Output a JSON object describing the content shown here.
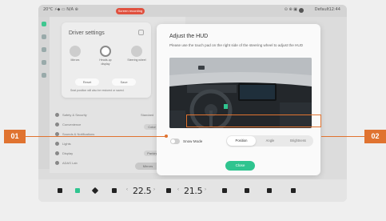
{
  "status": {
    "left": "20°C  ⚡◆  ▭ N/A  ⊕",
    "recording": "Screen recording",
    "right": "⊙   ⊕   ▣",
    "user": "Default",
    "time": "12:44"
  },
  "driver_settings": {
    "title": "Driver settings",
    "modes": [
      "Mirrors",
      "Heads-up display",
      "Steering wheel"
    ],
    "reset_label": "Reset",
    "save_label": "Save",
    "note": "Seat position will also be restored or saved."
  },
  "background_rows": [
    "Safety & Security",
    "Convenience",
    "Sounds & Notifications",
    "Lights",
    "Display",
    "ADAS Lab"
  ],
  "background_labels": {
    "standard": "Standard",
    "color": "Color",
    "parking": "Parking",
    "mirrors": "Mirrors"
  },
  "hud_dialog": {
    "title": "Adjust the HUD",
    "description": "Please use the touch pad on the right side of the steering wheel to adjust the HUD",
    "snow_mode_label": "Snow Mode",
    "snow_mode_on": false,
    "tabs": [
      "Position",
      "Angle",
      "Brightness"
    ],
    "active_tab": "Position",
    "close_label": "Close"
  },
  "dock": {
    "left_temp": "22.5",
    "right_temp": "21.5"
  },
  "callouts": {
    "left": "01",
    "right": "02"
  },
  "colors": {
    "accent_green": "#2fc48f",
    "callout_orange": "#e07330",
    "recording_red": "#e0503e"
  }
}
